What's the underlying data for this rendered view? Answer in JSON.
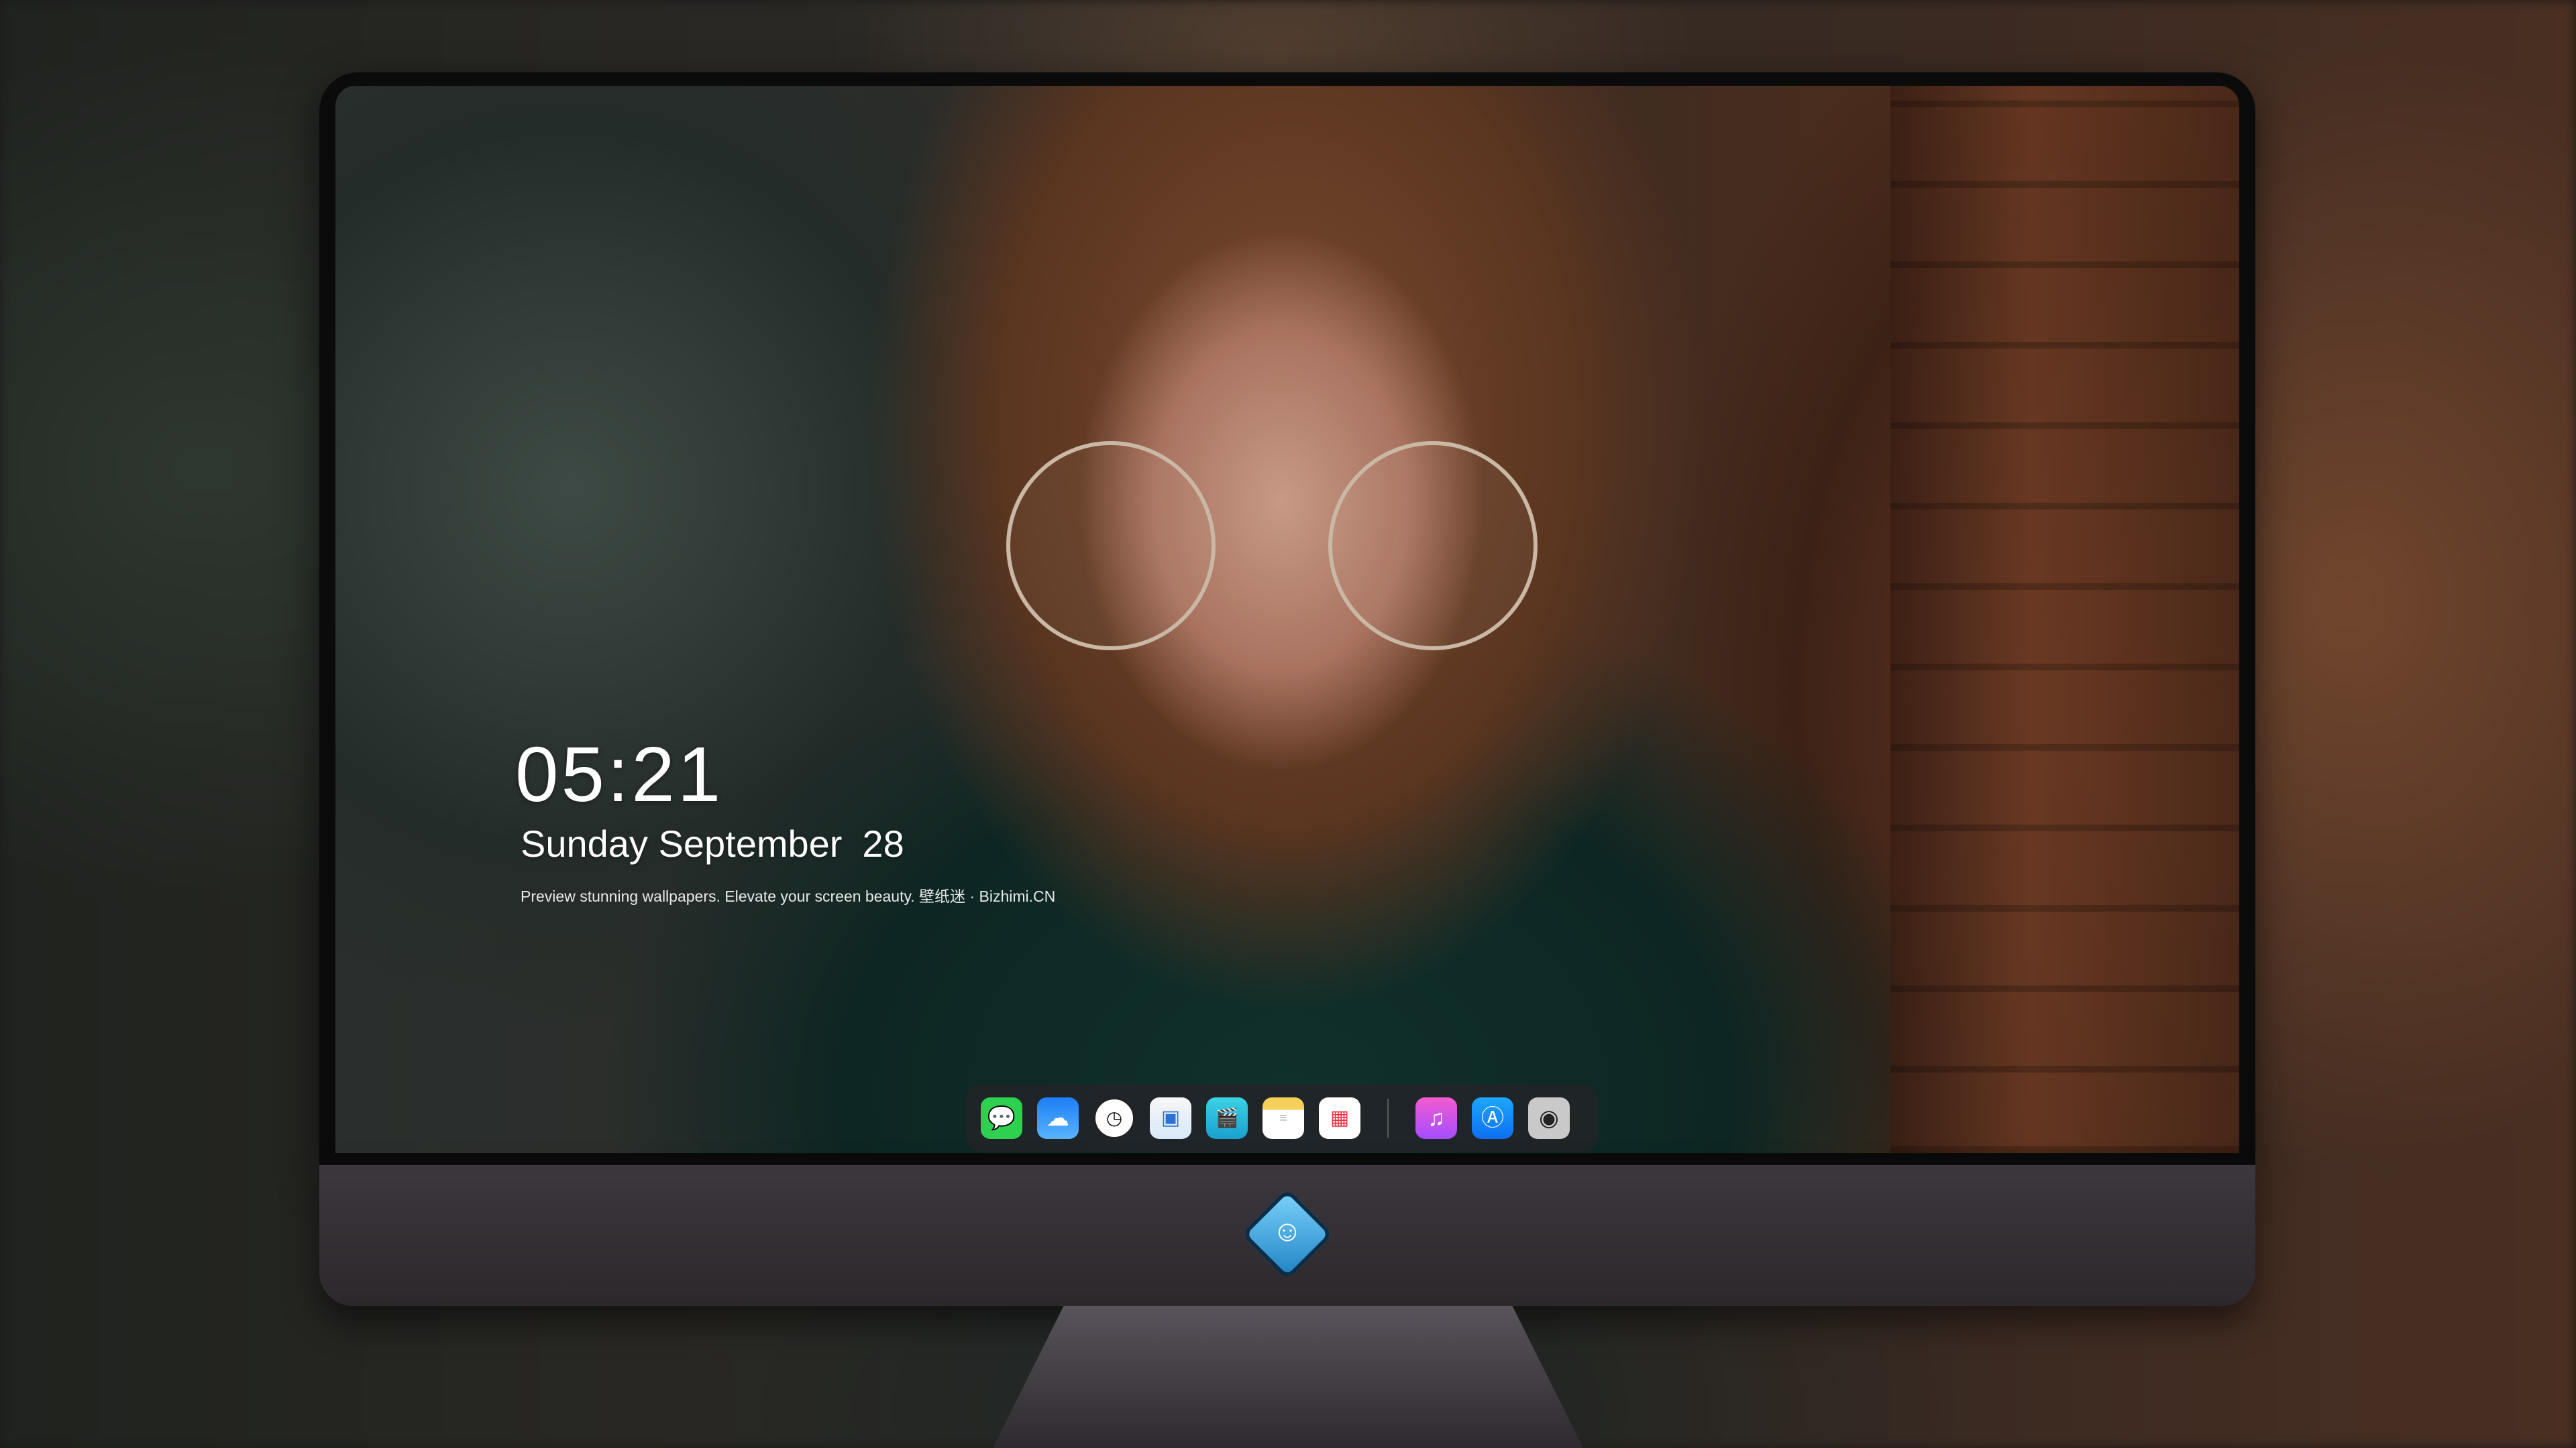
{
  "lockscreen": {
    "time": "05:21",
    "weekday_month": "Sunday September",
    "day": "28",
    "caption": "Preview stunning wallpapers. Elevate your screen beauty. 壁纸迷 · Bizhimi.CN"
  },
  "dock": {
    "apps": [
      {
        "name": "Messages",
        "icon": "message-icon",
        "glyph": "💬"
      },
      {
        "name": "Weather",
        "icon": "weather-icon",
        "glyph": "☁"
      },
      {
        "name": "Clock",
        "icon": "clock-icon",
        "glyph": "◷"
      },
      {
        "name": "Preview",
        "icon": "preview-icon",
        "glyph": "▣"
      },
      {
        "name": "Claquette",
        "icon": "clapper-icon",
        "glyph": "🎬"
      },
      {
        "name": "Notes",
        "icon": "notes-icon",
        "glyph": "≡"
      },
      {
        "name": "Photo Booth",
        "icon": "photos-icon",
        "glyph": "▦"
      },
      {
        "name": "Music",
        "icon": "music-icon",
        "glyph": "♫"
      },
      {
        "name": "App Store",
        "icon": "app-store-icon",
        "glyph": "Ⓐ"
      },
      {
        "name": "Camera",
        "icon": "camera-icon",
        "glyph": "◉"
      }
    ]
  },
  "colors": {
    "bezel": "#0b0b0c",
    "chin": "#3c373d",
    "dock": "#232328"
  }
}
